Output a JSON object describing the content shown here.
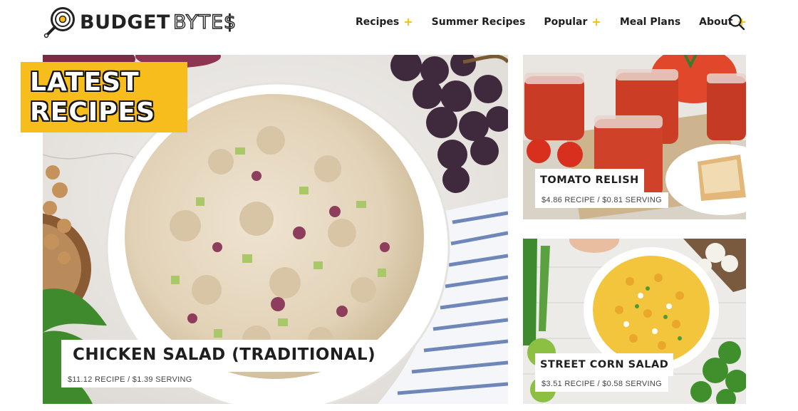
{
  "site": {
    "logo_word_1": "BUDGET",
    "logo_word_2": "BYTE$"
  },
  "nav": {
    "items": [
      {
        "label": "Recipes",
        "has_plus": true
      },
      {
        "label": "Summer Recipes",
        "has_plus": false
      },
      {
        "label": "Popular",
        "has_plus": true
      },
      {
        "label": "Meal Plans",
        "has_plus": false
      },
      {
        "label": "About",
        "has_plus": true
      }
    ],
    "plus_symbol": "+",
    "search_icon": "search-icon"
  },
  "latest_badge": {
    "line1": "LATEST",
    "line2": "RECIPES"
  },
  "recipes": {
    "main": {
      "title": "CHICKEN SALAD (TRADITIONAL)",
      "price": "$11.12 RECIPE / $1.39 SERVING"
    },
    "side_top": {
      "title": "TOMATO RELISH",
      "price": "$4.86 RECIPE / $0.81 SERVING"
    },
    "side_bottom": {
      "title": "STREET CORN SALAD",
      "price": "$3.51 RECIPE / $0.58 SERVING"
    }
  },
  "colors": {
    "accent_yellow": "#f7bd1d",
    "text_dark": "#1f1f1f"
  }
}
